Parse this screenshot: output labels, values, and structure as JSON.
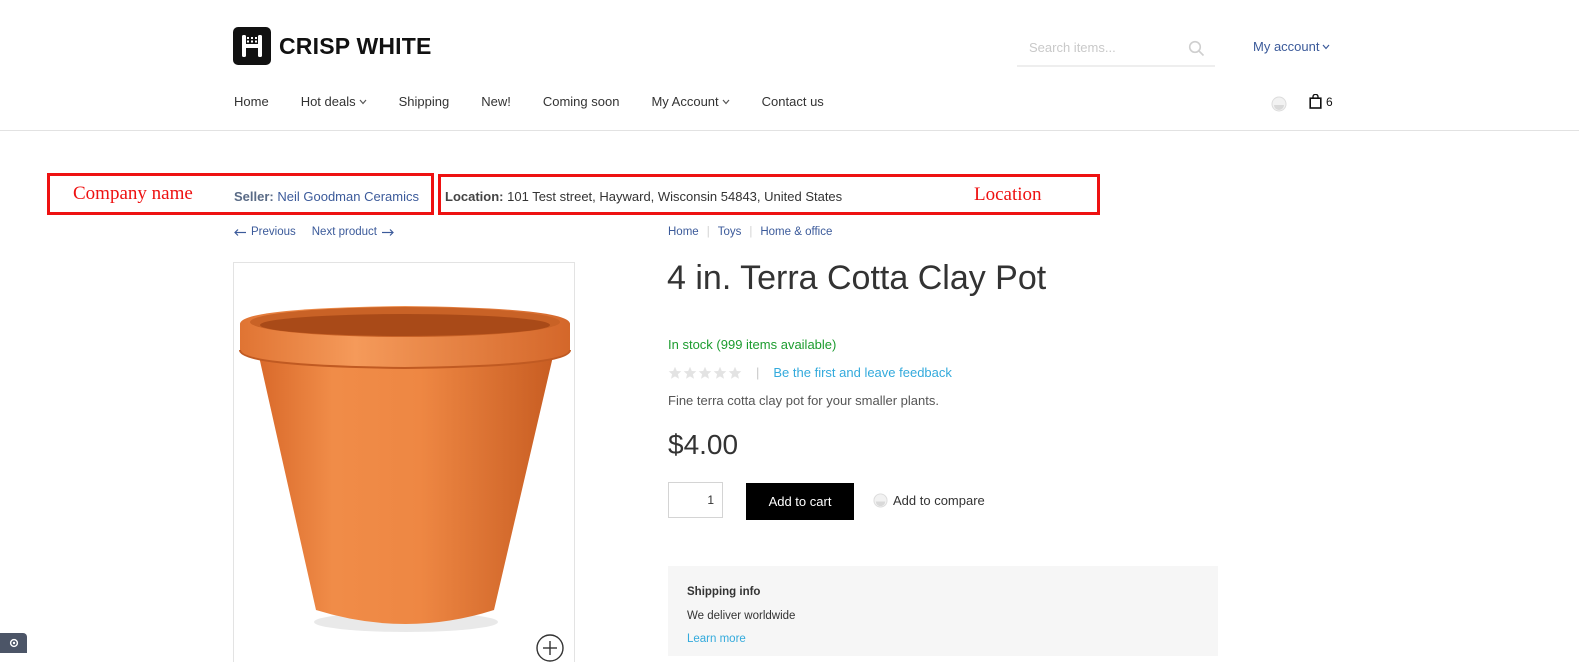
{
  "brand": {
    "name": "CRISP WHITE"
  },
  "search": {
    "placeholder": "Search items..."
  },
  "account": {
    "label": "My account"
  },
  "nav": {
    "items": [
      {
        "label": "Home",
        "has_dropdown": false
      },
      {
        "label": "Hot deals",
        "has_dropdown": true
      },
      {
        "label": "Shipping",
        "has_dropdown": false
      },
      {
        "label": "New!",
        "has_dropdown": false
      },
      {
        "label": "Coming soon",
        "has_dropdown": false
      },
      {
        "label": "My Account",
        "has_dropdown": true
      },
      {
        "label": "Contact us",
        "has_dropdown": false
      }
    ]
  },
  "cart": {
    "count": "6"
  },
  "annotations": {
    "company": "Company name",
    "location": "Location"
  },
  "vendor": {
    "seller_label": "Seller:",
    "seller_name": "Neil Goodman Ceramics",
    "location_label": "Location:",
    "location_value": "101 Test street, Hayward, Wisconsin 54843, United States"
  },
  "product_nav": {
    "previous": "Previous",
    "next": "Next product"
  },
  "breadcrumb": [
    "Home",
    "Toys",
    "Home & office"
  ],
  "product": {
    "title": "4 in. Terra Cotta Clay Pot",
    "stock": "In stock (999 items available)",
    "rating_stars": 0,
    "feedback_link": "Be the first and leave feedback",
    "description": "Fine terra cotta clay pot for your smaller plants.",
    "price": "$4.00",
    "quantity": "1",
    "add_to_cart": "Add to cart",
    "add_to_compare": "Add to compare"
  },
  "shipping": {
    "title": "Shipping info",
    "text": "We deliver worldwide",
    "link": "Learn more"
  },
  "colors": {
    "link": "#3b5a9a",
    "in_stock": "#1c9c2f",
    "annotation": "#ee1111",
    "feedback": "#33aadc",
    "button": "#000000"
  }
}
